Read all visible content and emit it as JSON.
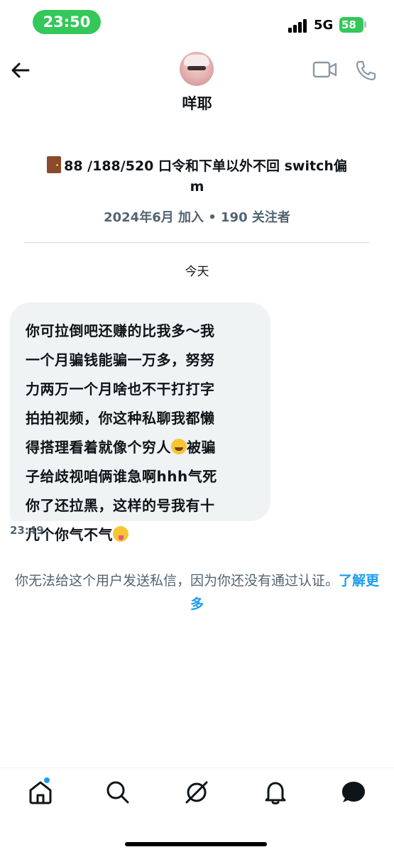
{
  "status_bar": {
    "time": "23:50",
    "network": "5G",
    "battery": "58"
  },
  "header": {
    "name": "咩耶",
    "back_icon": "arrow-left-icon",
    "video_icon": "video-camera-icon",
    "phone_icon": "phone-icon"
  },
  "profile": {
    "bio_line1": "88 /188/520 口令和下单以外不回 switch偏",
    "bio_line2": "m",
    "meta": "2024年6月 加入 • 190 关注者"
  },
  "conversation": {
    "date_separator": "今天",
    "message": {
      "lines": [
        "你可拉倒吧还赚的比我多～我",
        "一个月骗钱能骗一万多，努努",
        "力两万一个月啥也不干打打字",
        "拍拍视频，你这种私聊我都懒",
        "得搭理看着就像个穷人",
        "被骗",
        "子给歧视咱俩谁急啊hhh气死",
        "你了还拉黑，这样的号我有十",
        "几个你气不气"
      ],
      "time": "23:49"
    },
    "notice_text": "你无法给这个用户发送私信，因为你还没有通过认证。",
    "learn_more": "了解更多"
  },
  "bottom_nav": {
    "items": [
      "home-icon",
      "search-icon",
      "grok-icon",
      "bell-icon",
      "messages-icon"
    ],
    "accent": "#1d9bf0"
  }
}
